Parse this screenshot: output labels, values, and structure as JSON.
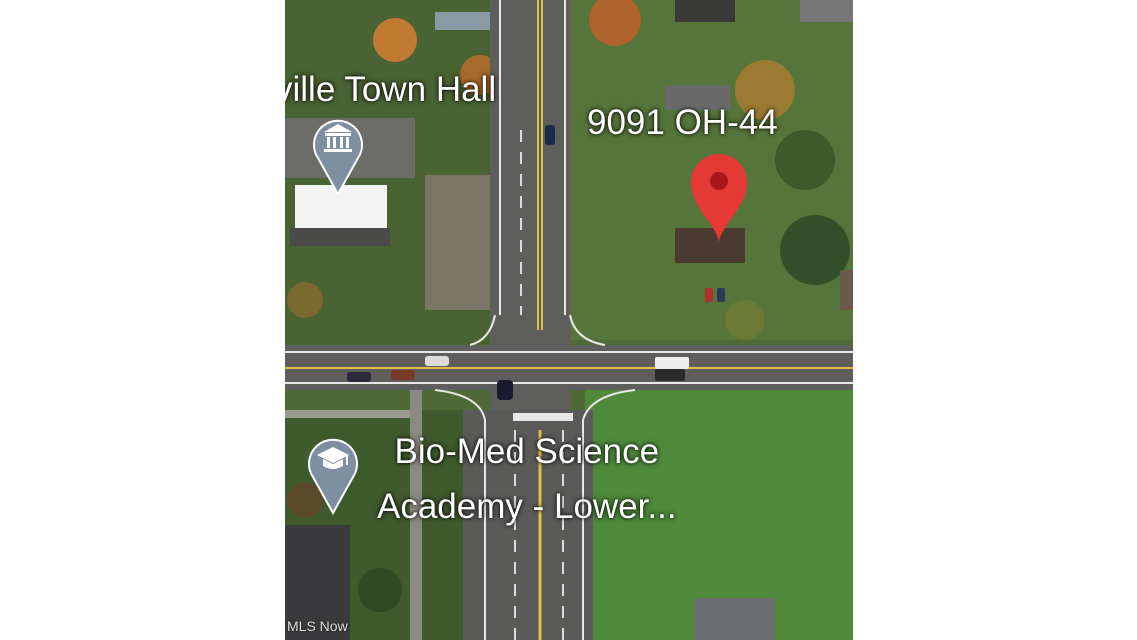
{
  "map": {
    "places": {
      "town_hall": {
        "name": "ville Town Hall",
        "icon": "town-hall-icon",
        "pin_color": "#7d8fa0"
      },
      "address": {
        "name": "9091 OH-44",
        "icon": "red-location-pin-icon",
        "pin_color": "#e53935"
      },
      "school": {
        "line1": "Bio-Med Science",
        "line2": "Academy -  Lower...",
        "icon": "graduation-cap-icon",
        "pin_color": "#7d8fa0"
      }
    },
    "watermark": "MLS Now"
  }
}
